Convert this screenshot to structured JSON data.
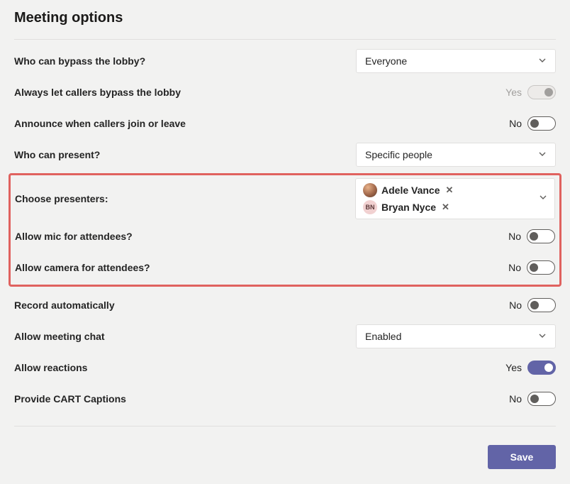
{
  "title": "Meeting options",
  "labels": {
    "bypass_lobby": "Who can bypass the lobby?",
    "callers_bypass": "Always let callers bypass the lobby",
    "announce": "Announce when callers join or leave",
    "who_present": "Who can present?",
    "choose_presenters": "Choose presenters:",
    "allow_mic": "Allow mic for attendees?",
    "allow_camera": "Allow camera for attendees?",
    "record_auto": "Record automatically",
    "allow_chat": "Allow meeting chat",
    "allow_reactions": "Allow reactions",
    "cart_captions": "Provide CART Captions"
  },
  "values": {
    "bypass_lobby": "Everyone",
    "who_present": "Specific people",
    "allow_chat": "Enabled"
  },
  "toggle_text": {
    "callers_bypass": "Yes",
    "announce": "No",
    "allow_mic": "No",
    "allow_camera": "No",
    "record_auto": "No",
    "allow_reactions": "Yes",
    "cart_captions": "No"
  },
  "presenters": [
    {
      "name": "Adele Vance",
      "avatar_type": "img",
      "initials": ""
    },
    {
      "name": "Bryan Nyce",
      "avatar_type": "initials",
      "initials": "BN"
    }
  ],
  "buttons": {
    "save": "Save"
  }
}
